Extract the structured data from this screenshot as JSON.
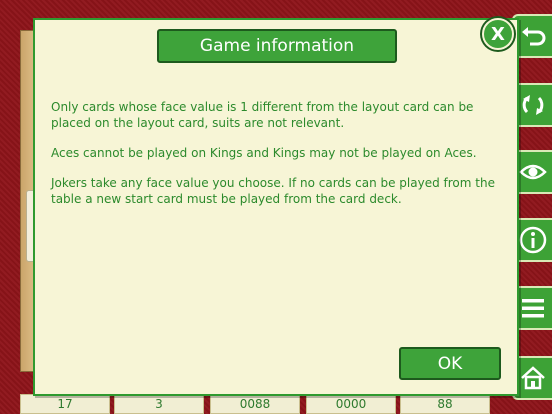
{
  "dialog": {
    "title": "Game information",
    "paragraphs": [
      "Only cards whose face value is 1 different from the layout card can be placed on the layout card, suits are not relevant.",
      "Aces cannot be played on Kings and Kings may not be played on Aces.",
      "Jokers take any face value you choose. If no cards can be played from the table a new start card must be played from the card deck."
    ],
    "ok_label": "OK",
    "close_label": "X"
  },
  "scores": [
    "17",
    "3",
    "0088",
    "0000",
    "88"
  ],
  "side_buttons": [
    "undo-icon",
    "restart-icon",
    "eye-icon",
    "info-icon",
    "menu-icon",
    "home-icon"
  ],
  "colors": {
    "felt": "#8e141a",
    "accent_green": "#3ea33a",
    "dialog_bg": "#f7f5d6",
    "text_green": "#2c8a2c"
  }
}
